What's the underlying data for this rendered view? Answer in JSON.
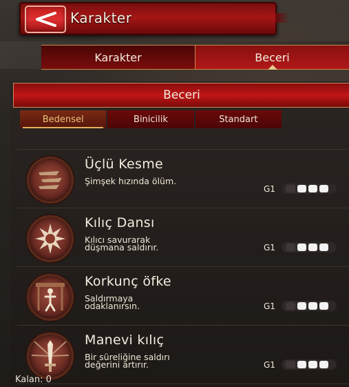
{
  "header": {
    "title": "Karakter",
    "back_icon": "back-arrow-icon"
  },
  "top_tabs": [
    {
      "label": "Karakter",
      "active": false
    },
    {
      "label": "Beceri",
      "active": true
    }
  ],
  "section": {
    "title": "Beceri"
  },
  "sub_tabs": [
    {
      "label": "Bedensel",
      "active": true
    },
    {
      "label": "Binicilik",
      "active": false
    },
    {
      "label": "Standart",
      "active": false
    }
  ],
  "skills": [
    {
      "name": "Üçlü Kesme",
      "desc_lines": [
        "Şimşek hızında ölüm."
      ],
      "level": "G1",
      "icon": "triple-slash-icon",
      "pips": 4,
      "filled": 3
    },
    {
      "name": "Kılıç Dansı",
      "desc_lines": [
        "Kılıcı savurarak",
        "düşmana saldırır."
      ],
      "level": "G1",
      "icon": "sword-dance-icon",
      "pips": 4,
      "filled": 3
    },
    {
      "name": "Korkunç öfke",
      "desc_lines": [
        "Saldırmaya",
        "odaklanırsın."
      ],
      "level": "G1",
      "icon": "fury-icon",
      "pips": 4,
      "filled": 3
    },
    {
      "name": "Manevi kılıç",
      "desc_lines": [
        "Bir süreliğine saldırı",
        "değerini artırır."
      ],
      "level": "G1",
      "icon": "spirit-sword-icon",
      "pips": 4,
      "filled": 3
    }
  ],
  "footer": {
    "remaining": "Kalan: 0"
  },
  "colors": {
    "accent_red": "#b01818",
    "gold": "#e6c27a"
  }
}
